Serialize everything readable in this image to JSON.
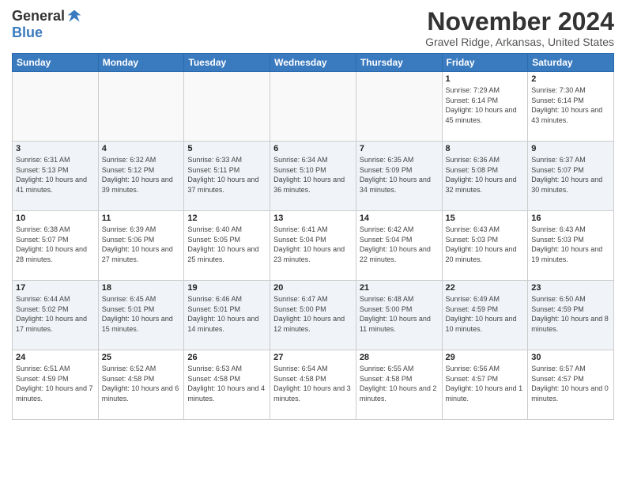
{
  "logo": {
    "general": "General",
    "blue": "Blue"
  },
  "header": {
    "title": "November 2024",
    "location": "Gravel Ridge, Arkansas, United States"
  },
  "weekdays": [
    "Sunday",
    "Monday",
    "Tuesday",
    "Wednesday",
    "Thursday",
    "Friday",
    "Saturday"
  ],
  "weeks": [
    [
      {
        "day": "",
        "info": ""
      },
      {
        "day": "",
        "info": ""
      },
      {
        "day": "",
        "info": ""
      },
      {
        "day": "",
        "info": ""
      },
      {
        "day": "",
        "info": ""
      },
      {
        "day": "1",
        "info": "Sunrise: 7:29 AM\nSunset: 6:14 PM\nDaylight: 10 hours and 45 minutes."
      },
      {
        "day": "2",
        "info": "Sunrise: 7:30 AM\nSunset: 6:14 PM\nDaylight: 10 hours and 43 minutes."
      }
    ],
    [
      {
        "day": "3",
        "info": "Sunrise: 6:31 AM\nSunset: 5:13 PM\nDaylight: 10 hours and 41 minutes."
      },
      {
        "day": "4",
        "info": "Sunrise: 6:32 AM\nSunset: 5:12 PM\nDaylight: 10 hours and 39 minutes."
      },
      {
        "day": "5",
        "info": "Sunrise: 6:33 AM\nSunset: 5:11 PM\nDaylight: 10 hours and 37 minutes."
      },
      {
        "day": "6",
        "info": "Sunrise: 6:34 AM\nSunset: 5:10 PM\nDaylight: 10 hours and 36 minutes."
      },
      {
        "day": "7",
        "info": "Sunrise: 6:35 AM\nSunset: 5:09 PM\nDaylight: 10 hours and 34 minutes."
      },
      {
        "day": "8",
        "info": "Sunrise: 6:36 AM\nSunset: 5:08 PM\nDaylight: 10 hours and 32 minutes."
      },
      {
        "day": "9",
        "info": "Sunrise: 6:37 AM\nSunset: 5:07 PM\nDaylight: 10 hours and 30 minutes."
      }
    ],
    [
      {
        "day": "10",
        "info": "Sunrise: 6:38 AM\nSunset: 5:07 PM\nDaylight: 10 hours and 28 minutes."
      },
      {
        "day": "11",
        "info": "Sunrise: 6:39 AM\nSunset: 5:06 PM\nDaylight: 10 hours and 27 minutes."
      },
      {
        "day": "12",
        "info": "Sunrise: 6:40 AM\nSunset: 5:05 PM\nDaylight: 10 hours and 25 minutes."
      },
      {
        "day": "13",
        "info": "Sunrise: 6:41 AM\nSunset: 5:04 PM\nDaylight: 10 hours and 23 minutes."
      },
      {
        "day": "14",
        "info": "Sunrise: 6:42 AM\nSunset: 5:04 PM\nDaylight: 10 hours and 22 minutes."
      },
      {
        "day": "15",
        "info": "Sunrise: 6:43 AM\nSunset: 5:03 PM\nDaylight: 10 hours and 20 minutes."
      },
      {
        "day": "16",
        "info": "Sunrise: 6:43 AM\nSunset: 5:03 PM\nDaylight: 10 hours and 19 minutes."
      }
    ],
    [
      {
        "day": "17",
        "info": "Sunrise: 6:44 AM\nSunset: 5:02 PM\nDaylight: 10 hours and 17 minutes."
      },
      {
        "day": "18",
        "info": "Sunrise: 6:45 AM\nSunset: 5:01 PM\nDaylight: 10 hours and 15 minutes."
      },
      {
        "day": "19",
        "info": "Sunrise: 6:46 AM\nSunset: 5:01 PM\nDaylight: 10 hours and 14 minutes."
      },
      {
        "day": "20",
        "info": "Sunrise: 6:47 AM\nSunset: 5:00 PM\nDaylight: 10 hours and 12 minutes."
      },
      {
        "day": "21",
        "info": "Sunrise: 6:48 AM\nSunset: 5:00 PM\nDaylight: 10 hours and 11 minutes."
      },
      {
        "day": "22",
        "info": "Sunrise: 6:49 AM\nSunset: 4:59 PM\nDaylight: 10 hours and 10 minutes."
      },
      {
        "day": "23",
        "info": "Sunrise: 6:50 AM\nSunset: 4:59 PM\nDaylight: 10 hours and 8 minutes."
      }
    ],
    [
      {
        "day": "24",
        "info": "Sunrise: 6:51 AM\nSunset: 4:59 PM\nDaylight: 10 hours and 7 minutes."
      },
      {
        "day": "25",
        "info": "Sunrise: 6:52 AM\nSunset: 4:58 PM\nDaylight: 10 hours and 6 minutes."
      },
      {
        "day": "26",
        "info": "Sunrise: 6:53 AM\nSunset: 4:58 PM\nDaylight: 10 hours and 4 minutes."
      },
      {
        "day": "27",
        "info": "Sunrise: 6:54 AM\nSunset: 4:58 PM\nDaylight: 10 hours and 3 minutes."
      },
      {
        "day": "28",
        "info": "Sunrise: 6:55 AM\nSunset: 4:58 PM\nDaylight: 10 hours and 2 minutes."
      },
      {
        "day": "29",
        "info": "Sunrise: 6:56 AM\nSunset: 4:57 PM\nDaylight: 10 hours and 1 minute."
      },
      {
        "day": "30",
        "info": "Sunrise: 6:57 AM\nSunset: 4:57 PM\nDaylight: 10 hours and 0 minutes."
      }
    ]
  ]
}
